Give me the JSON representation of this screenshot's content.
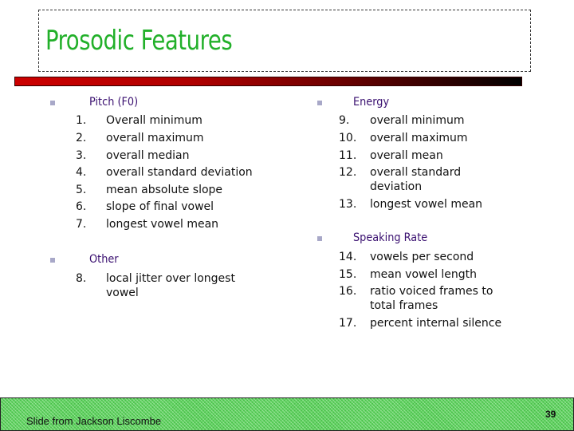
{
  "slide": {
    "title": "Prosodic Features",
    "colors": {
      "title": "#22b02a",
      "heading": "#3a1070",
      "footer_bg": "#5fd35f"
    }
  },
  "sections": {
    "pitch": {
      "heading": "Pitch (F0)",
      "items": [
        {
          "num": "1.",
          "text": "Overall minimum"
        },
        {
          "num": "2.",
          "text": "overall maximum"
        },
        {
          "num": "3.",
          "text": "overall median"
        },
        {
          "num": "4.",
          "text": "overall standard deviation"
        },
        {
          "num": "5.",
          "text": "mean absolute slope"
        },
        {
          "num": "6.",
          "text": "slope of final vowel"
        },
        {
          "num": "7.",
          "text": "longest vowel mean"
        }
      ]
    },
    "other": {
      "heading": "Other",
      "items": [
        {
          "num": "8.",
          "line1": "local jitter over longest",
          "line2": "vowel"
        }
      ]
    },
    "energy": {
      "heading": "Energy",
      "items": [
        {
          "num": "9.",
          "text": "overall minimum"
        },
        {
          "num": "10.",
          "text": "overall maximum"
        },
        {
          "num": "11.",
          "text": "overall mean"
        },
        {
          "num": "12.",
          "line1": "overall standard",
          "line2": "deviation"
        },
        {
          "num": "13.",
          "text": "longest vowel mean"
        }
      ]
    },
    "speaking_rate": {
      "heading": "Speaking Rate",
      "items": [
        {
          "num": "14.",
          "text": "vowels per second"
        },
        {
          "num": "15.",
          "text": "mean vowel length"
        },
        {
          "num": "16.",
          "line1": "ratio voiced frames to",
          "line2": "total frames"
        },
        {
          "num": "17.",
          "text": "percent internal silence"
        }
      ]
    }
  },
  "footer": {
    "credit": "Slide from Jackson Liscombe",
    "page_number": "39"
  }
}
